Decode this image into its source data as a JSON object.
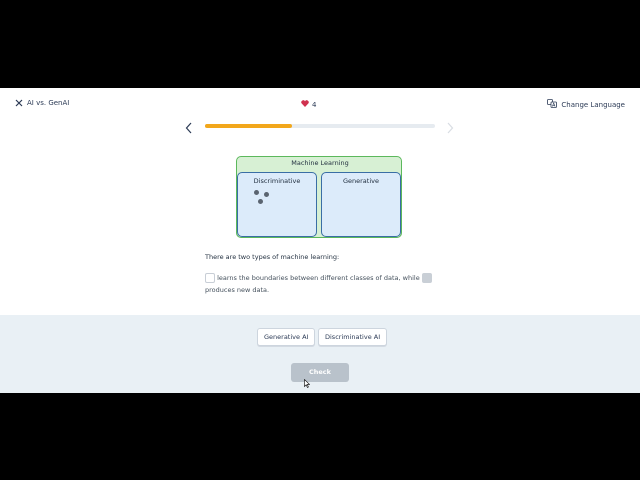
{
  "header": {
    "lesson_title": "AI vs. GenAI",
    "hearts": "4",
    "change_language": "Change Language"
  },
  "progress": {
    "value": 0.38
  },
  "diagram": {
    "outer_label": "Machine Learning",
    "left_label": "Discriminative",
    "right_label": "Generative"
  },
  "question": {
    "intro": "There are two types of machine learning:",
    "sentence_middle": "learns the boundaries between different classes of data, while",
    "sentence_end": "produces new data."
  },
  "options": [
    "Generative AI",
    "Discriminative AI"
  ],
  "actions": {
    "check_label": "Check"
  },
  "colors": {
    "accent_progress": "#f2a71b",
    "heart": "#d0314f",
    "ml_border": "#5cb85c",
    "sub_border": "#3a6ea5"
  },
  "icons": [
    "close-icon",
    "heart-icon",
    "translate-icon",
    "chevron-left-icon",
    "chevron-right-icon",
    "cursor-icon"
  ]
}
